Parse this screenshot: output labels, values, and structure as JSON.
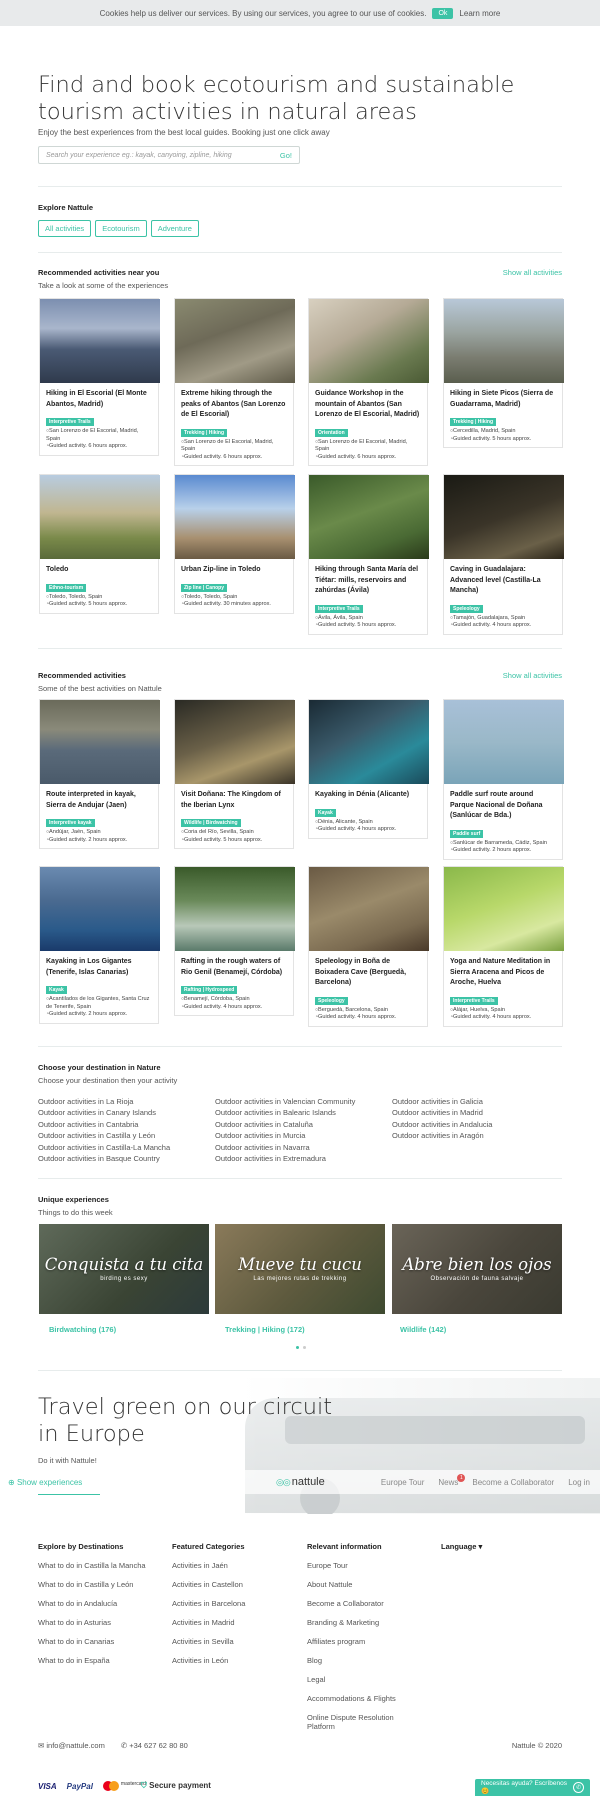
{
  "cookie": {
    "text": "Cookies help us deliver our services. By using our services, you agree to our use of cookies.",
    "ok": "Ok",
    "more": "Learn more"
  },
  "hero": {
    "title": "Find and book ecotourism and sustainable tourism activities in natural areas",
    "subtitle": "Enjoy the best experiences from the best local guides. Booking just one click away",
    "search_placeholder": "Search your experience eg.: kayak, canyoing, zipline, hiking",
    "search_go": "Go!"
  },
  "explore": {
    "title": "Explore Nattule",
    "chips": [
      "All activities",
      "Ecotourism",
      "Adventure"
    ]
  },
  "near": {
    "title": "Recommended activities near you",
    "subtitle": "Take a look at some of the experiences",
    "show_all": "Show all activities",
    "cards": [
      {
        "title": "Hiking in El Escorial (El Monte Abantos, Madrid)",
        "badge": "Interpretive Trails",
        "loc": "San Lorenzo de El Escorial, Madrid, Spain",
        "dur": "Guided activity. 6 hours approx."
      },
      {
        "title": "Extreme hiking through the peaks of Abantos (San Lorenzo de El Escorial)",
        "badge": "Trekking | Hiking",
        "loc": "San Lorenzo de El Escorial, Madrid, Spain",
        "dur": "Guided activity. 6 hours approx."
      },
      {
        "title": "Guidance Workshop in the mountain of Abantos (San Lorenzo de El Escorial, Madrid)",
        "badge": "Orientation",
        "loc": "San Lorenzo de El Escorial, Madrid, Spain",
        "dur": "Guided activity. 6 hours approx."
      },
      {
        "title": "Hiking in Siete Picos (Sierra de Guadarrama, Madrid)",
        "badge": "Trekking | Hiking",
        "loc": "Cercedilla, Madrid, Spain",
        "dur": "Guided activity. 5 hours approx."
      },
      {
        "title": "Toledo",
        "badge": "Ethno-tourism",
        "loc": "Toledo, Toledo, Spain",
        "dur": "Guided activity. 5 hours approx."
      },
      {
        "title": "Urban Zip-line in Toledo",
        "badge": "Zip line | Canopy",
        "loc": "Toledo, Toledo, Spain",
        "dur": "Guided activity. 30 minutes approx."
      },
      {
        "title": "Hiking through Santa María del Tiétar: mills, reservoirs and zahúrdas (Ávila)",
        "badge": "Interpretive Trails",
        "loc": "Ávila, Ávila, Spain",
        "dur": "Guided activity. 5 hours approx."
      },
      {
        "title": "Caving in Guadalajara: Advanced level (Castilla-La Mancha)",
        "badge": "Speleology",
        "loc": "Tamajón, Guadalajara, Spain",
        "dur": "Guided activity. 4 hours approx."
      }
    ]
  },
  "recommended": {
    "title": "Recommended activities",
    "subtitle": "Some of the best activities on Nattule",
    "show_all": "Show all activities",
    "cards": [
      {
        "title": "Route interpreted in kayak, Sierra de Andujar (Jaen)",
        "badge": "Interpretive kayak",
        "loc": "Andújar, Jaén, Spain",
        "dur": "Guided activity. 2 hours approx."
      },
      {
        "title": "Visit Doñana: The Kingdom of the Iberian Lynx",
        "badge": "Wildlife | Birdwatching",
        "loc": "Coria del Río, Sevilla, Spain",
        "dur": "Guided activity. 5 hours approx."
      },
      {
        "title": "Kayaking in Dénia (Alicante)",
        "badge": "Kayak",
        "loc": "Dénia, Alicante, Spain",
        "dur": "Guided activity. 4 hours approx."
      },
      {
        "title": "Paddle surf route around Parque Nacional de Doñana (Sanlúcar de Bda.)",
        "badge": "Paddle surf",
        "loc": "Sanlúcar de Barrameda, Cádiz, Spain",
        "dur": "Guided activity. 2 hours approx."
      },
      {
        "title": "Kayaking in Los Gigantes (Tenerife, Islas Canarias)",
        "badge": "Kayak",
        "loc": "Acantilados de los Gigantes, Santa Cruz de Tenerife, Spain",
        "dur": "Guided activity. 2 hours approx."
      },
      {
        "title": "Rafting in the rough waters of Rio Genil (Benamejí, Córdoba)",
        "badge": "Rafting | Hydrospeed",
        "loc": "Benamejí, Córdoba, Spain",
        "dur": "Guided activity. 4 hours approx."
      },
      {
        "title": "Speleology in Boña de Boixadera Cave (Berguedà, Barcelona)",
        "badge": "Speleology",
        "loc": "Berguedà, Barcelona, Spain",
        "dur": "Guided activity. 4 hours approx."
      },
      {
        "title": "Yoga and Nature Meditation in Sierra Aracena and Picos de Aroche, Huelva",
        "badge": "Interpretive Trails",
        "loc": "Alájar, Huelva, Spain",
        "dur": "Guided activity. 4 hours approx."
      }
    ]
  },
  "destinations": {
    "title": "Choose your destination in Nature",
    "subtitle": "Choose your destination then your activity",
    "col1": [
      "Outdoor activities in La Rioja",
      "Outdoor activities in Canary Islands",
      "Outdoor activities in Cantabria",
      "Outdoor activities in Castilla y León",
      "Outdoor activities in Castilla-La Mancha",
      "Outdoor activities in Basque Country"
    ],
    "col2": [
      "Outdoor activities in Valencian Community",
      "Outdoor activities in Balearic Islands",
      "Outdoor activities in Cataluña",
      "Outdoor activities in Murcia",
      "Outdoor activities in Navarra",
      "Outdoor activities in Extremadura"
    ],
    "col3": [
      "Outdoor activities in Galicia",
      "Outdoor activities in Madrid",
      "Outdoor activities in Andalucia",
      "Outdoor activities in Aragón"
    ]
  },
  "unique": {
    "title": "Unique experiences",
    "subtitle": "Things to do this week",
    "items": [
      {
        "big": "Conquista a tu cita",
        "small": "birding es sexy",
        "label": "Birdwatching (176)"
      },
      {
        "big": "Mueve tu cucu",
        "small": "Las mejores rutas de trekking",
        "label": "Trekking | Hiking (172)"
      },
      {
        "big": "Abre bien los ojos",
        "small": "Observación de fauna salvaje",
        "label": "Wildlife (142)"
      }
    ]
  },
  "circuit": {
    "title": "Travel green on our circuit in Europe",
    "subtitle": "Do it with Nattule!"
  },
  "navbar": {
    "show": "Show experiences",
    "logo": "nattule",
    "links": [
      "Europe Tour",
      "News",
      "Become a Collaborator",
      "Log in"
    ],
    "news_count": "1"
  },
  "footer": {
    "headings": [
      "Explore by Destinations",
      "Featured Categories",
      "Relevant information",
      "Language"
    ],
    "col1": [
      "What to do in Castilla la Mancha",
      "What to do in Castilla y León",
      "What to do in Andalucía",
      "What to do in Asturias",
      "What to do in Canarias",
      "What to do in España"
    ],
    "col2": [
      "Activities in Jaén",
      "Activities in Castellon",
      "Activities in Barcelona",
      "Activities in Madrid",
      "Activities in Sevilla",
      "Activities in León"
    ],
    "col3": [
      "Europe Tour",
      "About Nattule",
      "Become a Collaborator",
      "Branding & Marketing",
      "Affiliates program",
      "Blog",
      "Legal",
      "Accommodations & Flights",
      "Online Dispute Resolution Platform"
    ],
    "email": "info@nattule.com",
    "phone": "+34 627 62 80 80",
    "copyright": "Nattule © 2020",
    "pay": {
      "visa": "VISA",
      "paypal": "PayPal",
      "mc": "mastercard",
      "secure": "Secure payment"
    },
    "chat": "Necesitas ayuda? Escríbenos 😊"
  },
  "colors": {
    "accent": "#3cc3a6"
  }
}
